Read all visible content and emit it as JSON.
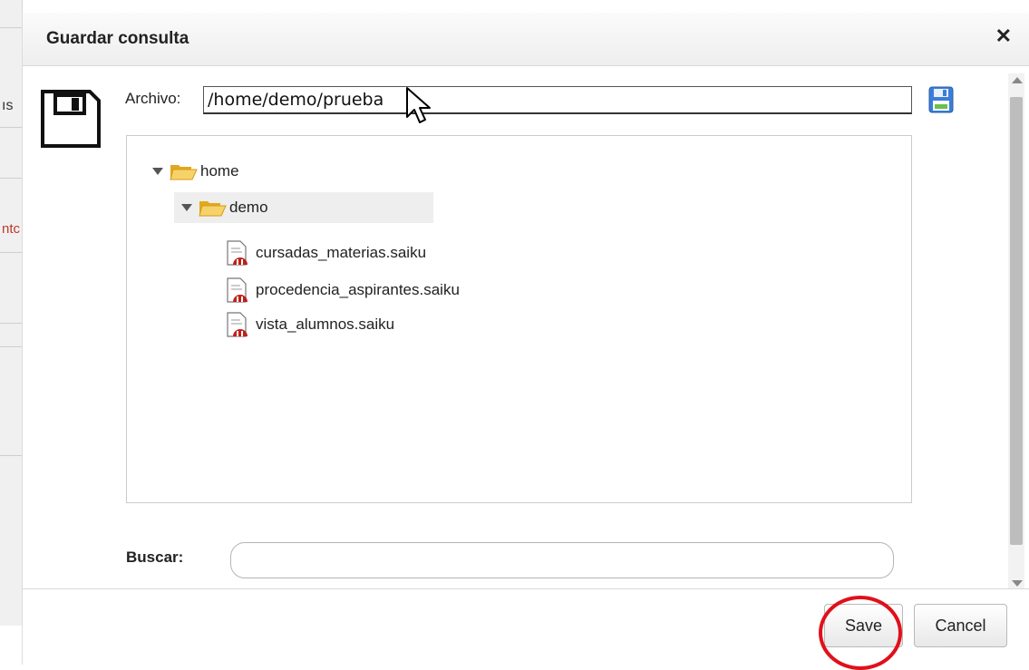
{
  "background": {
    "fragments": [
      "ıs",
      "ntc"
    ]
  },
  "dialog": {
    "title": "Guardar consulta",
    "close_glyph": "✕",
    "archivo": {
      "label": "Archivo:",
      "value": "/home/demo/prueba"
    },
    "tree": [
      {
        "label": "home",
        "type": "folder",
        "expanded": true
      },
      {
        "label": "demo",
        "type": "folder",
        "expanded": true,
        "selected": true
      },
      {
        "label": "cursadas_materias.saiku",
        "type": "file"
      },
      {
        "label": "procedencia_aspirantes.saiku",
        "type": "file"
      },
      {
        "label": "vista_alumnos.saiku",
        "type": "file"
      }
    ],
    "buscar": {
      "label": "Buscar:",
      "value": ""
    },
    "buttons": {
      "save": "Save",
      "cancel": "Cancel"
    }
  },
  "colors": {
    "highlight": "#e0101a",
    "folder": "#f0c040",
    "file_accent": "#c0201a",
    "save_icon": "#3b7dd8"
  },
  "icons": [
    "floppy-disk-icon",
    "save-icon",
    "folder-open-icon",
    "saiku-file-icon",
    "close-icon",
    "mouse-cursor-icon"
  ]
}
